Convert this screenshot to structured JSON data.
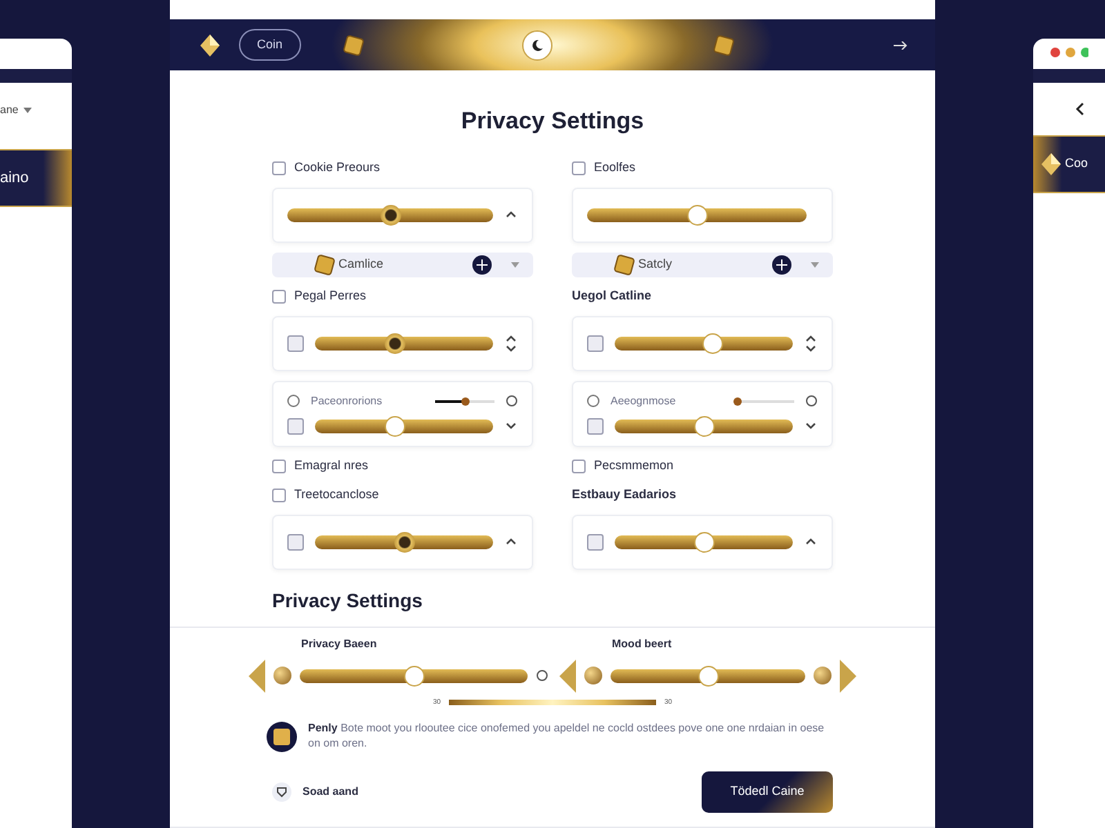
{
  "side_left": {
    "menu": "ane",
    "banner": "aino"
  },
  "side_right": {
    "banner": "Coo"
  },
  "header": {
    "coin_button": "Coin"
  },
  "title": "Privacy Settings",
  "columns": [
    [
      {
        "kind": "check",
        "label": "Cookie Preours",
        "checked": false
      },
      {
        "kind": "slider_card",
        "level": 0.5,
        "arrow_up": true,
        "arrow_down": false
      },
      {
        "kind": "select",
        "label": "Camlice"
      },
      {
        "kind": "check",
        "label": "Pegal Perres",
        "checked": false
      },
      {
        "kind": "slider_card",
        "checked": false,
        "level": 0.45,
        "arrow_up": true,
        "arrow_down": true
      },
      {
        "kind": "dual_card",
        "label": "Paceonrorions",
        "mini_slider": {
          "level": 0.5
        },
        "checked": false,
        "level": 0.45,
        "arrow_up": false,
        "arrow_down": true
      },
      {
        "kind": "check",
        "label": "Emagral nres",
        "checked": false
      },
      {
        "kind": "check",
        "label": "Treetocanclose",
        "checked": false
      },
      {
        "kind": "slider_card",
        "checked": false,
        "level": 0.5,
        "arrow_up": true,
        "arrow_down": false
      }
    ],
    [
      {
        "kind": "check",
        "label": "Eoolfes",
        "checked": false
      },
      {
        "kind": "slider_card",
        "level": 0.5,
        "arrow_up": false,
        "arrow_down": false
      },
      {
        "kind": "select",
        "label": "Satcly"
      },
      {
        "kind": "label",
        "label": "Uegol Catline"
      },
      {
        "kind": "slider_card",
        "checked": false,
        "level": 0.55,
        "arrow_up": true,
        "arrow_down": true
      },
      {
        "kind": "dual_card",
        "label": "Aeeognmose",
        "mini_slider": {
          "level": 0.05
        },
        "checked": false,
        "level": 0.5,
        "arrow_up": false,
        "arrow_down": true
      },
      {
        "kind": "check",
        "label": "Pecsmmemon",
        "checked": false
      },
      {
        "kind": "label",
        "label": "Estbauy Eadarios"
      },
      {
        "kind": "slider_card",
        "checked": false,
        "level": 0.5,
        "arrow_up": true,
        "arrow_down": false
      }
    ]
  ],
  "section_title": "Privacy Settings",
  "range_sliders": [
    {
      "label": "Privacy Baeen",
      "level": 0.5
    },
    {
      "label": "Mood beert",
      "level": 0.5
    }
  ],
  "scale": {
    "min_label": "30",
    "max_label": "30"
  },
  "notice": "**Penly** Bote moot you rlooutee cice onofemed you apeldel ne cocld ostdees pove one one nrdaian in oese on om oren.",
  "footer": {
    "link": "Soad aand",
    "button": "Tödedl Caine"
  }
}
